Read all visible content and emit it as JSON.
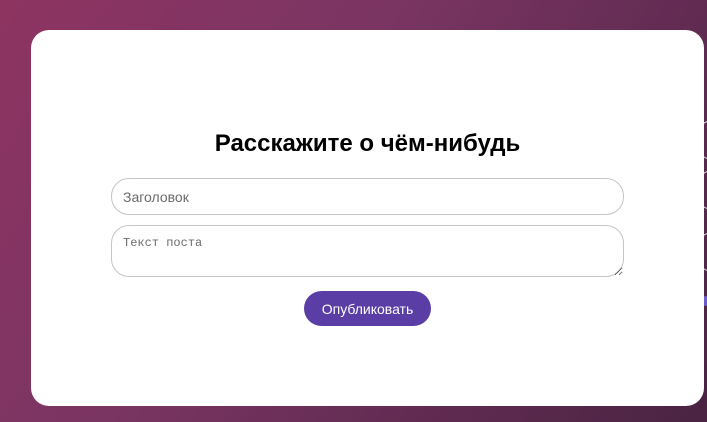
{
  "form": {
    "heading": "Расскажите о чём-нибудь",
    "title_placeholder": "Заголовок",
    "title_value": "",
    "body_placeholder": "Текст поста",
    "body_value": "",
    "publish_label": "Опубликовать"
  },
  "colors": {
    "accent": "#5a3ea6",
    "card_background": "#ffffff",
    "page_background_start": "#8e3461",
    "page_background_end": "#4a2442"
  }
}
